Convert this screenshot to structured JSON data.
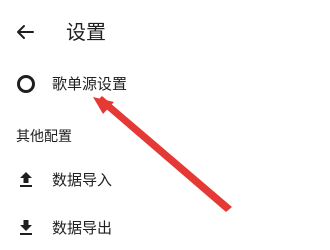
{
  "app_bar": {
    "title": "设置",
    "back_icon": "arrow-left-icon"
  },
  "items": [
    {
      "label": "歌单源设置",
      "icon": "radio-ring-icon"
    }
  ],
  "other_section": {
    "header": "其他配置",
    "items": [
      {
        "label": "数据导入",
        "icon": "upload-icon"
      },
      {
        "label": "数据导出",
        "icon": "download-icon"
      }
    ]
  },
  "annotation": {
    "arrow_color": "#e53935"
  }
}
